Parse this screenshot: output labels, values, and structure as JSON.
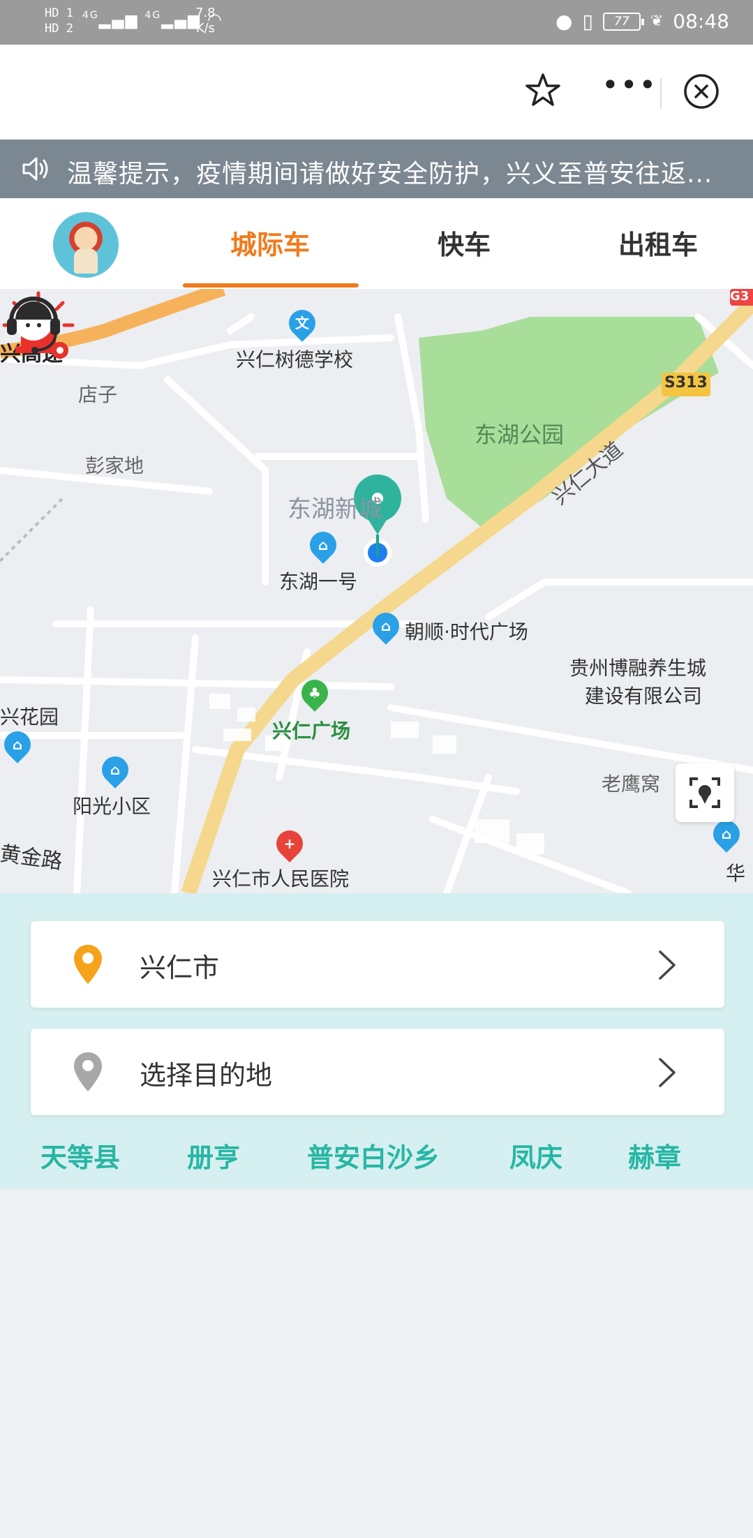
{
  "status_bar": {
    "left_tags": [
      "HD 1",
      "HD 2"
    ],
    "network": "4G",
    "speed_value": "7.8",
    "speed_unit": "K/s",
    "battery": "77",
    "time": "08:48"
  },
  "toolbar": {
    "star_icon": "star-outline-icon",
    "more_icon": "more-dots-icon",
    "close_icon": "close-circle-icon"
  },
  "notice": {
    "icon": "speaker-icon",
    "text": "温馨提示，疫情期间请做好安全防护，兴义至普安往返..."
  },
  "tabs": {
    "items": [
      {
        "label": "城际车",
        "active": true
      },
      {
        "label": "快车",
        "active": false
      },
      {
        "label": "出租车",
        "active": false
      }
    ],
    "accent": "#f07a1c"
  },
  "map": {
    "labels": {
      "highway": "兴高速",
      "school": "兴仁树德学校",
      "dianzi": "店子",
      "pengjiadi": "彭家地",
      "park": "东湖公园",
      "road_s313": "S313",
      "avenue": "兴仁大道",
      "new_city": "东湖新城",
      "dongyi": "东湖一号",
      "plaza": "朝顺·时代广场",
      "company_line1": "贵州博融养生城",
      "company_line2": "建设有限公司",
      "garden": "兴花园",
      "xr_square": "兴仁广场",
      "yangguang": "阳光小区",
      "laoyingwo": "老鹰窝",
      "huangjin": "黄金路",
      "hospital": "兴仁市人民医院",
      "corner": "G3",
      "hua": "华"
    },
    "poi_glyphs": {
      "school": "文",
      "building": "⌂",
      "tree": "♣",
      "hospital": "+"
    }
  },
  "booking": {
    "origin": "兴仁市",
    "destination_placeholder": "选择目的地",
    "quick_destinations": [
      "天等县",
      "册亨",
      "普安白沙乡",
      "凤庆",
      "赫章"
    ],
    "accent": "#27b6a4"
  }
}
